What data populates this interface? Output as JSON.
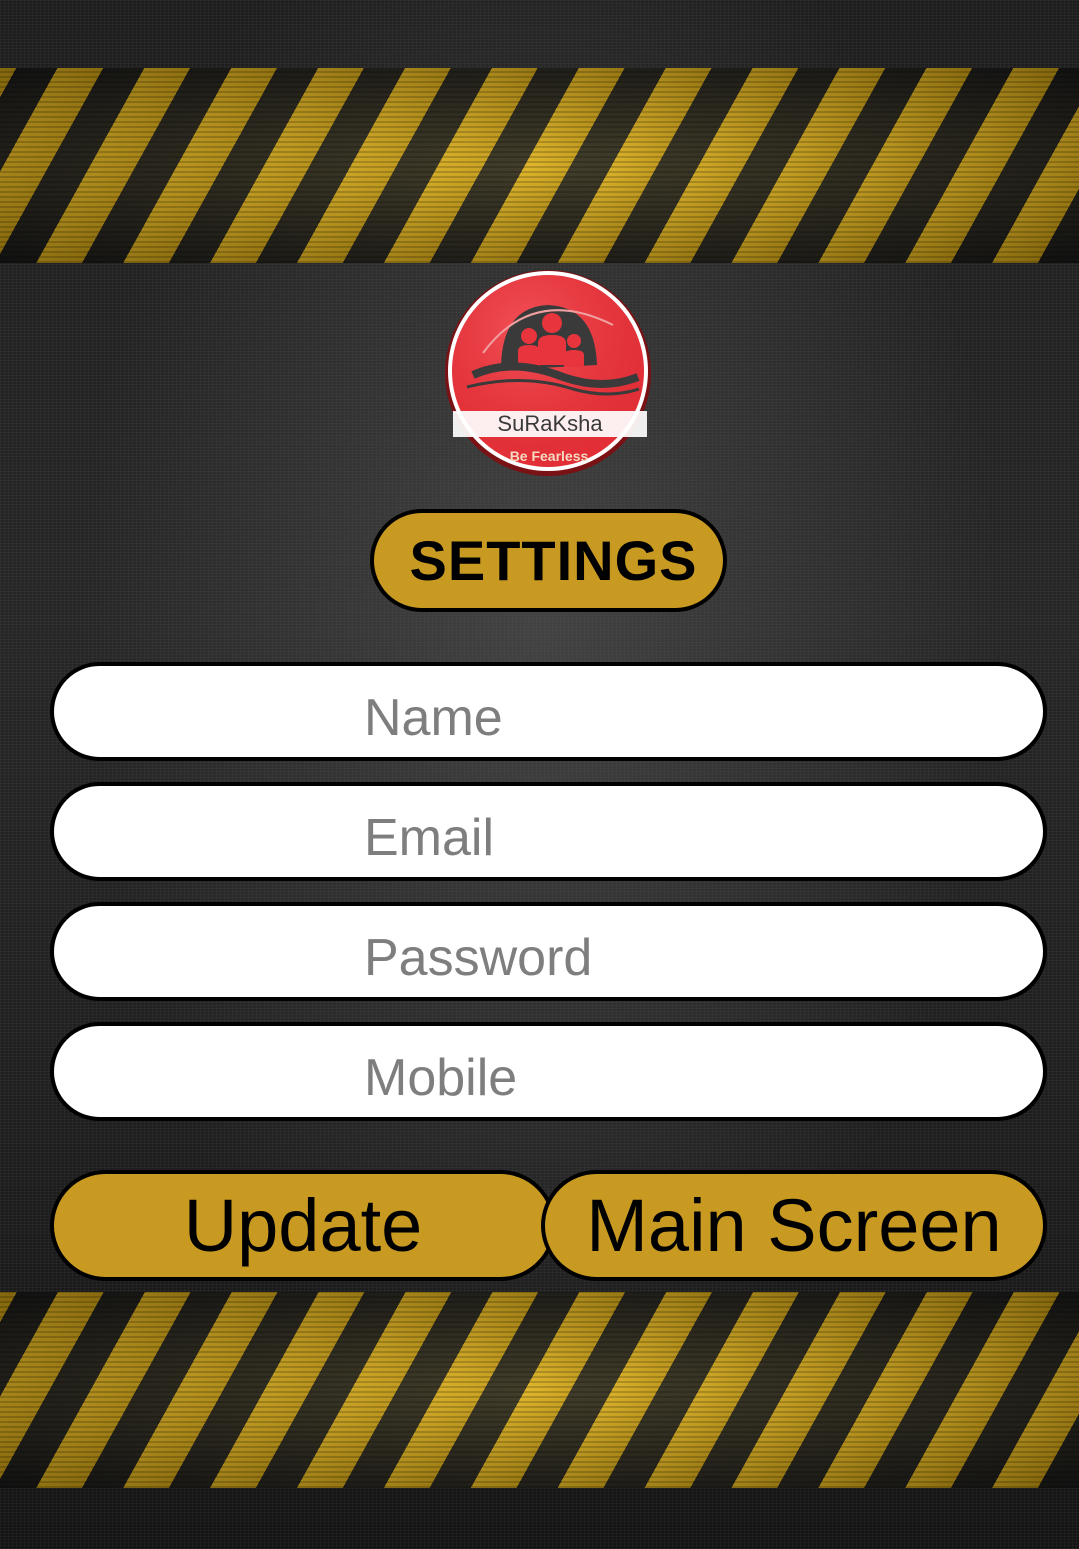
{
  "logo": {
    "brand_text": "SuRaKsha",
    "tagline": "Be Fearless",
    "colors": {
      "disc": "#e8353d",
      "ring": "#ffffff",
      "figures": "#3a3a3a"
    }
  },
  "header": {
    "title": "SETTINGS"
  },
  "form": {
    "name": {
      "placeholder": "Name",
      "value": ""
    },
    "email": {
      "placeholder": "Email",
      "value": ""
    },
    "password": {
      "placeholder": "Password",
      "value": ""
    },
    "mobile": {
      "placeholder": "Mobile",
      "value": ""
    }
  },
  "actions": {
    "update_label": "Update",
    "main_screen_label": "Main Screen"
  },
  "theme": {
    "accent": "#c99a22",
    "stripe_yellow": "#d9ac1c",
    "background": "#1f1f1f"
  }
}
